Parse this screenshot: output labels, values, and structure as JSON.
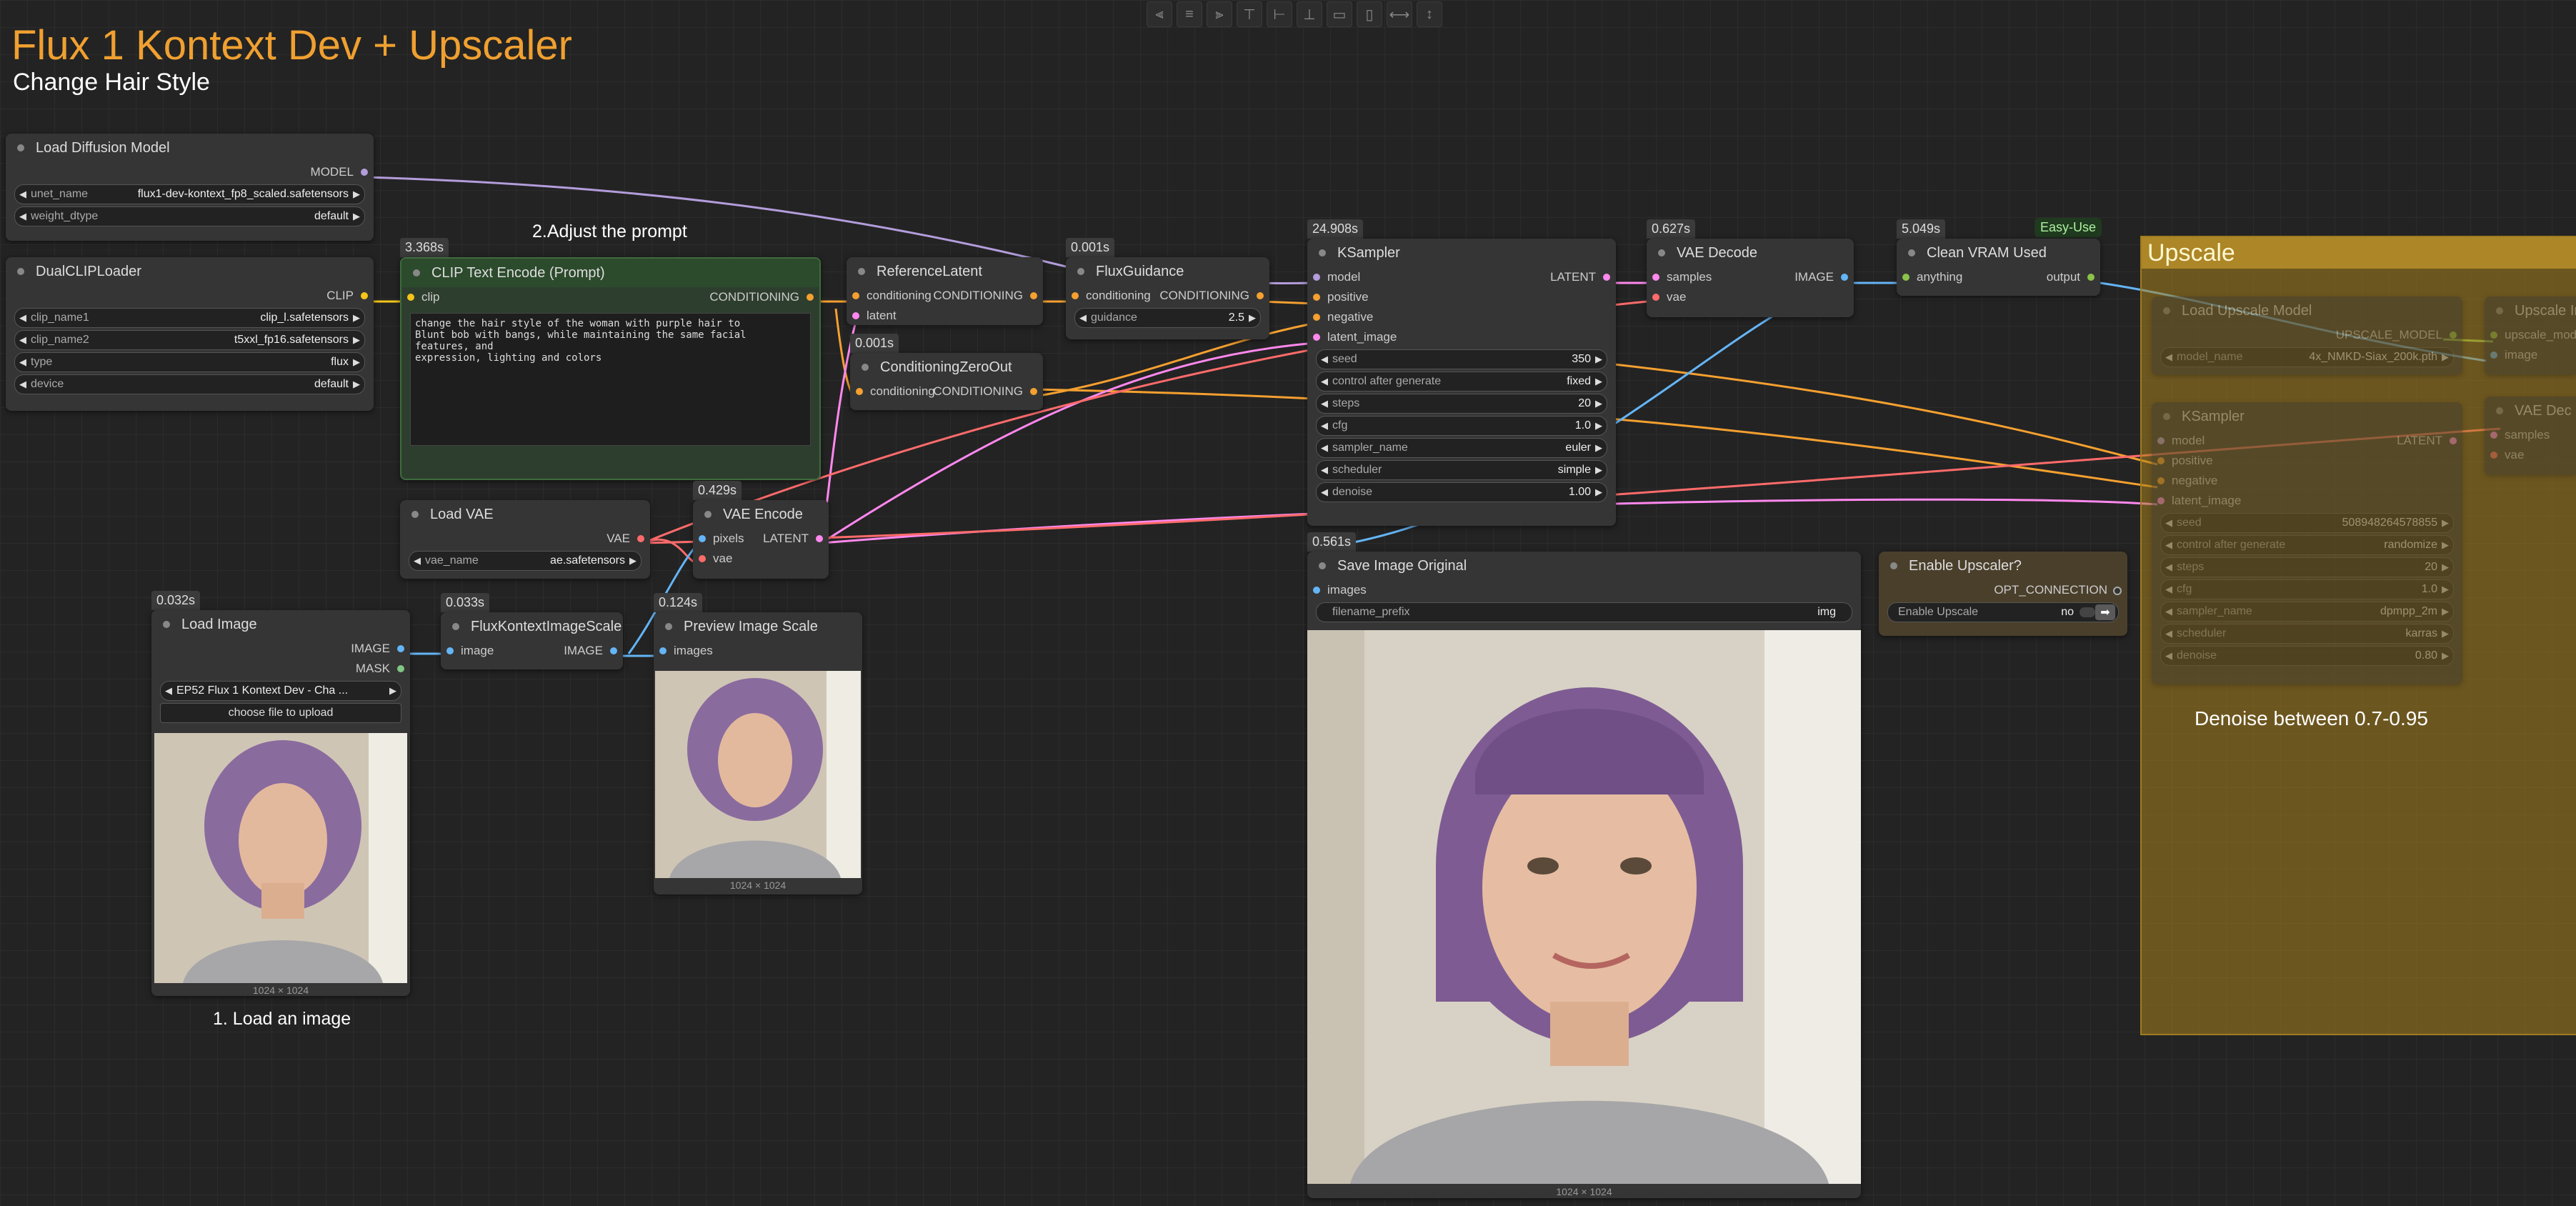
{
  "header": {
    "title": "Flux 1 Kontext Dev + Upscaler",
    "subtitle": "Change Hair Style"
  },
  "notes": {
    "adjust_prompt": "2.Adjust the prompt",
    "load_image": "1. Load an image",
    "denoise_hint": "Denoise between 0.7-0.95"
  },
  "toolbar_icons": [
    "align-left-icon",
    "align-center-icon",
    "align-right-icon",
    "align-top-icon",
    "align-middle-icon",
    "align-bottom-icon",
    "distribute-h-icon",
    "distribute-v-icon",
    "resize-w-icon",
    "resize-h-icon"
  ],
  "colors": {
    "clip": "#f5c518",
    "conditioning": "#f5a030",
    "latent": "#ff88ee",
    "model": "#b39ddb",
    "image": "#64b5f6",
    "vae": "#ff6b6b",
    "mask": "#81c784",
    "any": "#8bc34a",
    "group": "#b08a28"
  },
  "nodes": {
    "load_diffusion": {
      "title": "Load Diffusion Model",
      "out_model": "MODEL",
      "unet_label": "unet_name",
      "unet_value": "flux1-dev-kontext_fp8_scaled.safetensors",
      "dtype_label": "weight_dtype",
      "dtype_value": "default"
    },
    "dual_clip": {
      "title": "DualCLIPLoader",
      "out_clip": "CLIP",
      "clip1_label": "clip_name1",
      "clip1_value": "clip_l.safetensors",
      "clip2_label": "clip_name2",
      "clip2_value": "t5xxl_fp16.safetensors",
      "type_label": "type",
      "type_value": "flux",
      "device_label": "device",
      "device_value": "default"
    },
    "clip_text": {
      "timing": "3.368s",
      "title": "CLIP Text Encode (Prompt)",
      "in_clip": "clip",
      "out": "CONDITIONING",
      "prompt": "change the hair style of the woman with purple hair to\nBlunt bob with bangs, while maintaining the same facial features, and\nexpression, lighting and colors"
    },
    "ref_latent": {
      "title": "ReferenceLatent",
      "in_cond": "conditioning",
      "in_latent": "latent",
      "out": "CONDITIONING"
    },
    "zero_out": {
      "timing": "0.001s",
      "title": "ConditioningZeroOut",
      "in_cond": "conditioning",
      "out": "CONDITIONING"
    },
    "flux_guidance": {
      "timing": "0.001s",
      "title": "FluxGuidance",
      "in_cond": "conditioning",
      "out": "CONDITIONING",
      "guidance_label": "guidance",
      "guidance_value": "2.5"
    },
    "ksampler": {
      "timing": "24.908s",
      "title": "KSampler",
      "in_model": "model",
      "in_positive": "positive",
      "in_negative": "negative",
      "in_latent": "latent_image",
      "out": "LATENT",
      "widgets": [
        {
          "label": "seed",
          "value": "350"
        },
        {
          "label": "control after generate",
          "value": "fixed"
        },
        {
          "label": "steps",
          "value": "20"
        },
        {
          "label": "cfg",
          "value": "1.0"
        },
        {
          "label": "sampler_name",
          "value": "euler"
        },
        {
          "label": "scheduler",
          "value": "simple"
        },
        {
          "label": "denoise",
          "value": "1.00"
        }
      ]
    },
    "vae_decode": {
      "timing": "0.627s",
      "title": "VAE Decode",
      "in_samples": "samples",
      "in_vae": "vae",
      "out": "IMAGE"
    },
    "clean_vram": {
      "timing": "5.049s",
      "badge": "Easy-Use",
      "title": "Clean VRAM Used",
      "in_anything": "anything",
      "out": "output"
    },
    "load_vae": {
      "title": "Load VAE",
      "out": "VAE",
      "vae_label": "vae_name",
      "vae_value": "ae.safetensors"
    },
    "vae_encode": {
      "timing": "0.429s",
      "title": "VAE Encode",
      "in_pixels": "pixels",
      "in_vae": "vae",
      "out": "LATENT"
    },
    "load_image": {
      "timing": "0.032s",
      "title": "Load Image",
      "out_image": "IMAGE",
      "out_mask": "MASK",
      "image_value": "EP52 Flux 1 Kontext Dev - Cha ...",
      "upload": "choose file to upload",
      "caption": "1024 × 1024"
    },
    "kontext_scale": {
      "timing": "0.033s",
      "title": "FluxKontextImageScale",
      "in_image": "image",
      "out": "IMAGE"
    },
    "preview": {
      "timing": "0.124s",
      "title": "Preview Image Scale",
      "in_images": "images",
      "caption": "1024 × 1024"
    },
    "save_image": {
      "timing": "0.561s",
      "title": "Save Image Original",
      "in_images": "images",
      "prefix_label": "filename_prefix",
      "prefix_value": "img",
      "caption": "1024 × 1024"
    },
    "enable_upscaler": {
      "title": "Enable Upscaler?",
      "out": "OPT_CONNECTION",
      "toggle_label": "Enable Upscale",
      "toggle_value": "no"
    }
  },
  "group": {
    "title": "Upscale",
    "load_upscale": {
      "title": "Load Upscale Model",
      "out": "UPSCALE_MODEL",
      "model_label": "model_name",
      "model_value": "4x_NMKD-Siax_200k.pth"
    },
    "ksampler2": {
      "title": "KSampler",
      "in_model": "model",
      "in_positive": "positive",
      "in_negative": "negative",
      "in_latent": "latent_image",
      "out": "LATENT",
      "widgets": [
        {
          "label": "seed",
          "value": "508948264578855"
        },
        {
          "label": "control after generate",
          "value": "randomize"
        },
        {
          "label": "steps",
          "value": "20"
        },
        {
          "label": "cfg",
          "value": "1.0"
        },
        {
          "label": "sampler_name",
          "value": "dpmpp_2m"
        },
        {
          "label": "scheduler",
          "value": "karras"
        },
        {
          "label": "denoise",
          "value": "0.80"
        }
      ]
    },
    "upscale_image": {
      "title": "Upscale Ima",
      "in_upscale": "upscale_model",
      "in_image": "image"
    },
    "vae_decode2": {
      "title": "VAE Dec",
      "in_samples": "samples",
      "in_vae": "vae"
    }
  }
}
